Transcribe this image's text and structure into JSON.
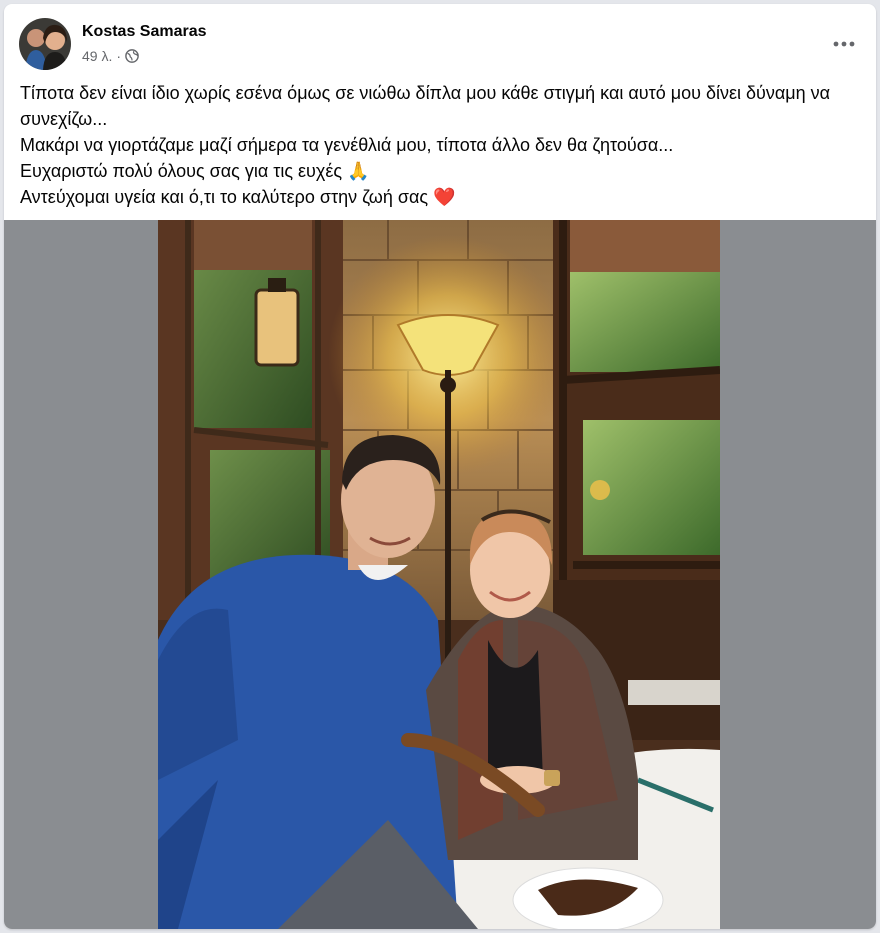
{
  "post": {
    "author": "Kostas Samaras",
    "timestamp": "49 λ.",
    "separator": "·",
    "privacy_icon": "globe-icon",
    "more_icon": "more-horizontal-icon",
    "lines": [
      "Τίποτα δεν είναι ίδιο χωρίς εσένα όμως σε νιώθω δίπλα μου κάθε στιγμή και αυτό μου δίνει δύναμη να συνεχίζω...",
      "Μακάρι να γιορτάζαμε μαζί σήμερα τα γενέθλιά μου, τίποτα άλλο δεν θα ζητούσα...",
      "Ευχαριστώ πολύ όλους σας για τις ευχές 🙏",
      "Αντεύχομαι υγεία και ό,τι το καλύτερο στην ζωή σας ❤️"
    ]
  },
  "colors": {
    "card_bg": "#ffffff",
    "page_bg": "#e4e6eb",
    "secondary_text": "#65676b",
    "photo_frame": "#8a8d91",
    "heart": "#e0245e"
  }
}
